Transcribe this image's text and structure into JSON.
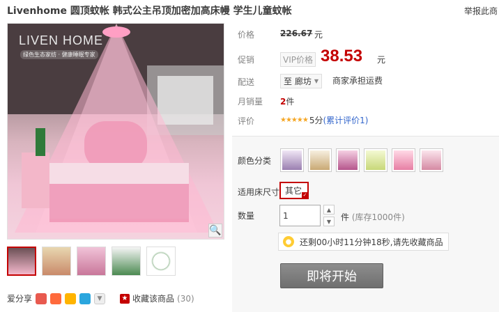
{
  "title": "Livenhome 圆顶蚊帐 韩式公主吊顶加密加高床幔 学生儿童蚊帐",
  "report_link": "举报此商",
  "main_image": {
    "brand": "LIVEN HOME",
    "brand_sub": "绿色生态家纺 · 健康睡眠专家"
  },
  "price": {
    "label": "价格",
    "original": "226.67",
    "currency": "元"
  },
  "promo": {
    "label": "促销",
    "vip_tag": "VIP价格",
    "value": "38.53",
    "currency": "元"
  },
  "delivery": {
    "label": "配送",
    "location": "至 廊坊",
    "note": "商家承担运费"
  },
  "monthly_sales": {
    "label": "月销量",
    "value": "2",
    "unit": "件"
  },
  "review": {
    "label": "评价",
    "stars": "★★★★★",
    "score": "5分",
    "link": "(累计评价1)"
  },
  "sku": {
    "color_label": "颜色分类",
    "size_label": "适用床尺寸",
    "size_value": "其它",
    "qty_label": "数量",
    "qty_value": "1",
    "qty_unit": "件",
    "stock": "(库存1000件)"
  },
  "timer_text": "还剩00小时11分钟18秒,请先收藏商品",
  "buy_button": "即将开始",
  "share": {
    "label": "爱分享"
  },
  "favorite": {
    "label": "收藏该商品",
    "count": "(30)"
  },
  "colors": {
    "accent": "#c40000",
    "link": "#3366cc",
    "button": "#7a7a7a"
  }
}
